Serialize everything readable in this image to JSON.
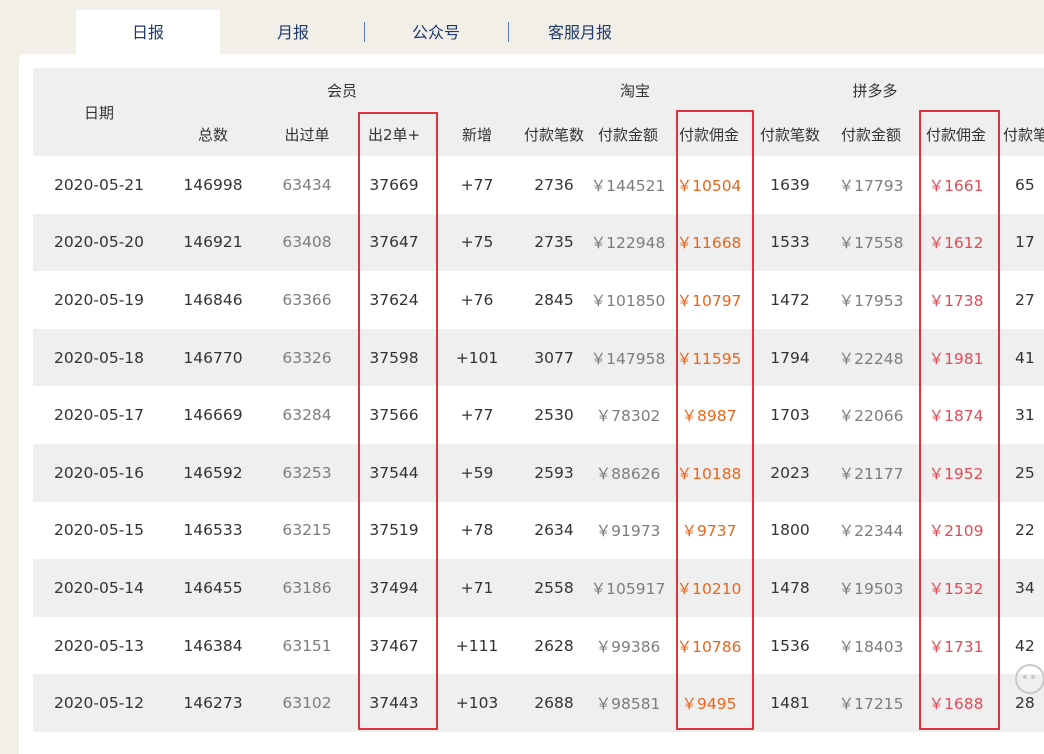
{
  "tabs": [
    {
      "label": "日报",
      "active": true
    },
    {
      "label": "月报",
      "active": false
    },
    {
      "label": "公众号",
      "active": false
    },
    {
      "label": "客服月报",
      "active": false
    }
  ],
  "table": {
    "date_header": "日期",
    "groups": {
      "member": "会员",
      "taobao": "淘宝",
      "pdd": "拼多多"
    },
    "subheaders": [
      "总数",
      "出过单",
      "出2单+",
      "新增",
      "付款笔数",
      "付款金额",
      "付款佣金",
      "付款笔数",
      "付款金额",
      "付款佣金",
      "付款笔数"
    ],
    "rows": [
      {
        "date": "2020-05-21",
        "total": "146998",
        "ordered": "63434",
        "two_plus": "37669",
        "new": "+77",
        "tb_count": "2736",
        "tb_amount": "￥144521",
        "tb_comm": "￥10504",
        "pdd_count": "1639",
        "pdd_amount": "￥17793",
        "pdd_comm": "￥1661",
        "extra": "65"
      },
      {
        "date": "2020-05-20",
        "total": "146921",
        "ordered": "63408",
        "two_plus": "37647",
        "new": "+75",
        "tb_count": "2735",
        "tb_amount": "￥122948",
        "tb_comm": "￥11668",
        "pdd_count": "1533",
        "pdd_amount": "￥17558",
        "pdd_comm": "￥1612",
        "extra": "17"
      },
      {
        "date": "2020-05-19",
        "total": "146846",
        "ordered": "63366",
        "two_plus": "37624",
        "new": "+76",
        "tb_count": "2845",
        "tb_amount": "￥101850",
        "tb_comm": "￥10797",
        "pdd_count": "1472",
        "pdd_amount": "￥17953",
        "pdd_comm": "￥1738",
        "extra": "27"
      },
      {
        "date": "2020-05-18",
        "total": "146770",
        "ordered": "63326",
        "two_plus": "37598",
        "new": "+101",
        "tb_count": "3077",
        "tb_amount": "￥147958",
        "tb_comm": "￥11595",
        "pdd_count": "1794",
        "pdd_amount": "￥22248",
        "pdd_comm": "￥1981",
        "extra": "41"
      },
      {
        "date": "2020-05-17",
        "total": "146669",
        "ordered": "63284",
        "two_plus": "37566",
        "new": "+77",
        "tb_count": "2530",
        "tb_amount": "￥78302",
        "tb_comm": "￥8987",
        "pdd_count": "1703",
        "pdd_amount": "￥22066",
        "pdd_comm": "￥1874",
        "extra": "31"
      },
      {
        "date": "2020-05-16",
        "total": "146592",
        "ordered": "63253",
        "two_plus": "37544",
        "new": "+59",
        "tb_count": "2593",
        "tb_amount": "￥88626",
        "tb_comm": "￥10188",
        "pdd_count": "2023",
        "pdd_amount": "￥21177",
        "pdd_comm": "￥1952",
        "extra": "25"
      },
      {
        "date": "2020-05-15",
        "total": "146533",
        "ordered": "63215",
        "two_plus": "37519",
        "new": "+78",
        "tb_count": "2634",
        "tb_amount": "￥91973",
        "tb_comm": "￥9737",
        "pdd_count": "1800",
        "pdd_amount": "￥22344",
        "pdd_comm": "￥2109",
        "extra": "22"
      },
      {
        "date": "2020-05-14",
        "total": "146455",
        "ordered": "63186",
        "two_plus": "37494",
        "new": "+71",
        "tb_count": "2558",
        "tb_amount": "￥105917",
        "tb_comm": "￥10210",
        "pdd_count": "1478",
        "pdd_amount": "￥19503",
        "pdd_comm": "￥1532",
        "extra": "34"
      },
      {
        "date": "2020-05-13",
        "total": "146384",
        "ordered": "63151",
        "two_plus": "37467",
        "new": "+111",
        "tb_count": "2628",
        "tb_amount": "￥99386",
        "tb_comm": "￥10786",
        "pdd_count": "1536",
        "pdd_amount": "￥18403",
        "pdd_comm": "￥1731",
        "extra": "42"
      },
      {
        "date": "2020-05-12",
        "total": "146273",
        "ordered": "63102",
        "two_plus": "37443",
        "new": "+103",
        "tb_count": "2688",
        "tb_amount": "￥98581",
        "tb_comm": "￥9495",
        "pdd_count": "1481",
        "pdd_amount": "￥17215",
        "pdd_comm": "￥1688",
        "extra": "28"
      }
    ]
  },
  "colors": {
    "background": "#f1efe8",
    "tab_text": "#1f3a68",
    "taobao_accent": "#e8651c",
    "pdd_accent": "#e34b58",
    "highlight_border": "#e0343a"
  },
  "icons": {
    "watermark": "wechat-watermark-icon"
  }
}
